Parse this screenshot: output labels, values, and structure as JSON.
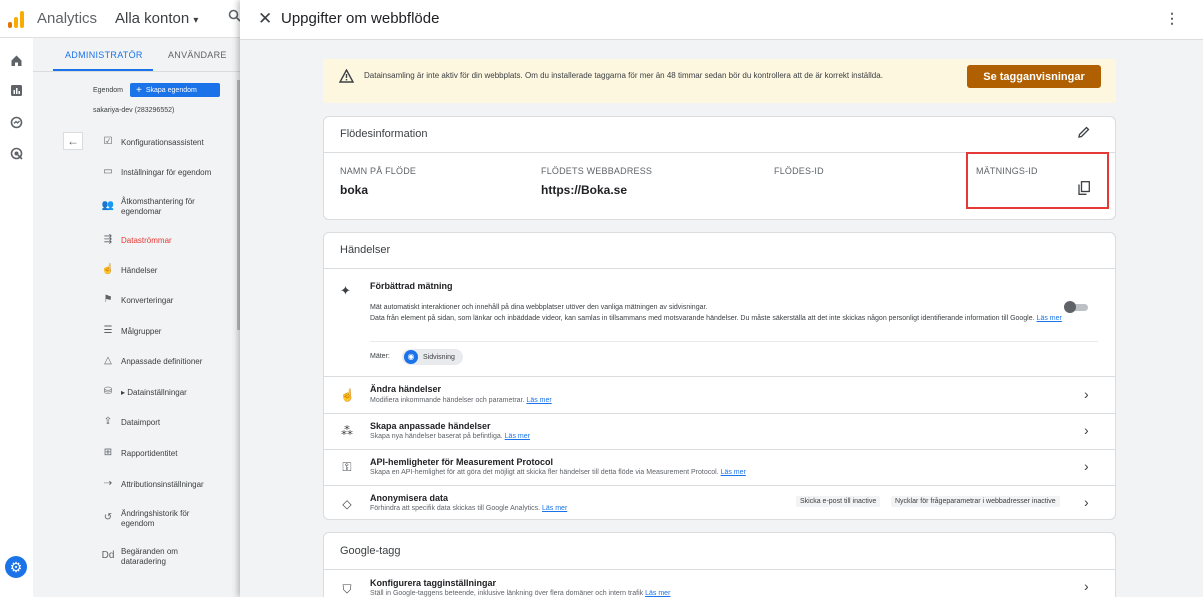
{
  "topbar": {
    "app_name": "Analytics",
    "account_select": "Alla konton",
    "account_caret": "▾",
    "search_icon": "search-icon"
  },
  "admin": {
    "tabs": [
      "ADMINISTRATÖR",
      "ANVÄNDARE"
    ],
    "active_tab": 0,
    "property_label": "Egendom",
    "create_property": "Skapa egendom",
    "property_id": "sakariya-dev (283296552)",
    "menu": [
      {
        "label": "Konfigurationsassistent",
        "icon": "checklist-icon"
      },
      {
        "label": "Inställningar för egendom",
        "icon": "property-settings-icon"
      },
      {
        "label": "Åtkomsthantering för egendomar",
        "icon": "people-icon"
      },
      {
        "label": "Dataströmmar",
        "icon": "data-streams-icon",
        "active": true
      },
      {
        "label": "Händelser",
        "icon": "touch-icon"
      },
      {
        "label": "Konverteringar",
        "icon": "flag-icon"
      },
      {
        "label": "Målgrupper",
        "icon": "audience-icon"
      },
      {
        "label": "Anpassade definitioner",
        "icon": "shapes-icon"
      },
      {
        "label": "Datainställningar",
        "icon": "database-icon",
        "prefix": "▸"
      },
      {
        "label": "Dataimport",
        "icon": "upload-icon"
      },
      {
        "label": "Rapportidentitet",
        "icon": "report-identity-icon"
      },
      {
        "label": "Attributionsinställningar",
        "icon": "attribution-icon"
      },
      {
        "label": "Ändringshistorik för egendom",
        "icon": "history-icon"
      },
      {
        "label": "Begäranden om dataradering",
        "icon": "data-deletion-icon"
      }
    ]
  },
  "drawer": {
    "title": "Uppgifter om webbflöde",
    "banner": {
      "text": "Datainsamling är inte aktiv för din webbplats. Om du installerade taggarna för mer än 48 timmar sedan bör du kontrollera att de är korrekt inställda.",
      "button": "Se tagganvisningar",
      "warn_color": "#e37400",
      "button_color": "#b06000"
    },
    "flow": {
      "title": "Flödesinformation",
      "columns": [
        {
          "label": "NAMN PÅ FLÖDE",
          "value": "boka"
        },
        {
          "label": "FLÖDETS WEBBADRESS",
          "value": "https://Boka.se"
        },
        {
          "label": "FLÖDES-ID",
          "value": ""
        },
        {
          "label": "MÄTNINGS-ID",
          "value": ""
        }
      ],
      "highlight_color": "#e53935"
    },
    "events": {
      "title": "Händelser",
      "enhanced": {
        "title": "Förbättrad mätning",
        "desc1": "Mät automatiskt interaktioner och innehåll på dina webbplatser utöver den vanliga mätningen av sidvisningar.",
        "desc2": "Data från element på sidan, som länkar och inbäddade videor, kan samlas in tillsammans med motsvarande händelser. Du måste säkerställa att det inte skickas någon personligt identifierande information till Google.",
        "link": "Läs mer",
        "toggle_on": false,
        "measures_label": "Mäter:",
        "chip": "Sidvisning"
      },
      "rows": [
        {
          "title": "Ändra händelser",
          "desc": "Modifiera inkommande händelser och parametrar.",
          "link": "Läs mer",
          "icon": "touch-icon"
        },
        {
          "title": "Skapa anpassade händelser",
          "desc": "Skapa nya händelser baserat på befintliga.",
          "link": "Läs mer",
          "icon": "sparkle-click-icon"
        },
        {
          "title": "API-hemligheter för Measurement Protocol",
          "desc": "Skapa en API-hemlighet för att göra det möjligt att skicka fler händelser till detta flöde via Measurement Protocol.",
          "link": "Läs mer",
          "icon": "key-icon"
        },
        {
          "title": "Anonymisera data",
          "desc": "Förhindra att specifik data skickas till Google Analytics.",
          "link": "Läs mer",
          "icon": "eraser-icon",
          "tags": [
            "Skicka e-post till inactive",
            "Nycklar för frågeparametrar i webbadresser inactive"
          ]
        }
      ]
    },
    "gtag": {
      "title": "Google-tagg",
      "row_title": "Konfigurera tagginställningar",
      "row_desc": "Ställ in Google-taggens beteende, inklusive länkning över flera domäner och intern trafik",
      "row_link": "Läs mer",
      "icon": "tag-icon"
    }
  }
}
